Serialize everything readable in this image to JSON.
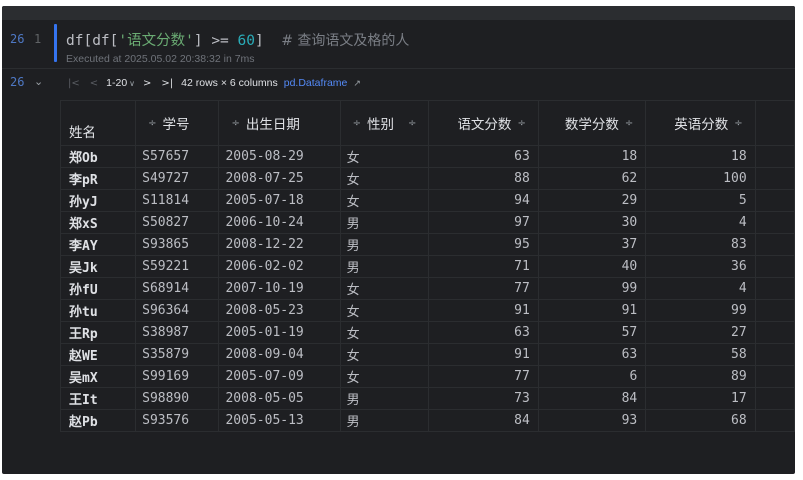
{
  "cell": {
    "execution_count": "26",
    "line_number": "1",
    "code": {
      "prefix": "df[df[",
      "string": "'语文分数'",
      "middle": "] >= ",
      "number": "60",
      "suffix": "]  ",
      "comment": "# 查询语文及格的人"
    },
    "executed_at": "Executed at 2025.05.02 20:38:32 in 7ms"
  },
  "output": {
    "execution_count": "26",
    "pager": {
      "first": "|<",
      "prev": "<",
      "range": "1-20",
      "next": ">",
      "last": ">|",
      "summary": "42 rows × 6 columns",
      "type_link": "pd.Dataframe",
      "ext_icon": "↗"
    },
    "table": {
      "index_name": "姓名",
      "columns": [
        {
          "key": "id",
          "label": "学号",
          "align": "left"
        },
        {
          "key": "dob",
          "label": "出生日期",
          "align": "left"
        },
        {
          "key": "sex",
          "label": "性别",
          "align": "left"
        },
        {
          "key": "chinese",
          "label": "语文分数",
          "align": "right"
        },
        {
          "key": "math",
          "label": "数学分数",
          "align": "right"
        },
        {
          "key": "english",
          "label": "英语分数",
          "align": "right"
        }
      ],
      "rows": [
        {
          "name": "郑Ob",
          "id": "S57657",
          "dob": "2005-08-29",
          "sex": "女",
          "chinese": "63",
          "math": "18",
          "english": "18"
        },
        {
          "name": "李pR",
          "id": "S49727",
          "dob": "2008-07-25",
          "sex": "女",
          "chinese": "88",
          "math": "62",
          "english": "100"
        },
        {
          "name": "孙yJ",
          "id": "S11814",
          "dob": "2005-07-18",
          "sex": "女",
          "chinese": "94",
          "math": "29",
          "english": "5"
        },
        {
          "name": "郑xS",
          "id": "S50827",
          "dob": "2006-10-24",
          "sex": "男",
          "chinese": "97",
          "math": "30",
          "english": "4"
        },
        {
          "name": "李AY",
          "id": "S93865",
          "dob": "2008-12-22",
          "sex": "男",
          "chinese": "95",
          "math": "37",
          "english": "83"
        },
        {
          "name": "吴Jk",
          "id": "S59221",
          "dob": "2006-02-02",
          "sex": "男",
          "chinese": "71",
          "math": "40",
          "english": "36"
        },
        {
          "name": "孙fU",
          "id": "S68914",
          "dob": "2007-10-19",
          "sex": "女",
          "chinese": "77",
          "math": "99",
          "english": "4"
        },
        {
          "name": "孙tu",
          "id": "S96364",
          "dob": "2008-05-23",
          "sex": "女",
          "chinese": "91",
          "math": "91",
          "english": "99"
        },
        {
          "name": "王Rp",
          "id": "S38987",
          "dob": "2005-01-19",
          "sex": "女",
          "chinese": "63",
          "math": "57",
          "english": "27"
        },
        {
          "name": "赵WE",
          "id": "S35879",
          "dob": "2008-09-04",
          "sex": "女",
          "chinese": "91",
          "math": "63",
          "english": "58"
        },
        {
          "name": "吴mX",
          "id": "S99169",
          "dob": "2005-07-09",
          "sex": "女",
          "chinese": "77",
          "math": "6",
          "english": "89"
        },
        {
          "name": "王It",
          "id": "S98890",
          "dob": "2008-05-05",
          "sex": "男",
          "chinese": "73",
          "math": "84",
          "english": "17"
        },
        {
          "name": "赵Pb",
          "id": "S93576",
          "dob": "2005-05-13",
          "sex": "男",
          "chinese": "84",
          "math": "93",
          "english": "68"
        }
      ]
    }
  },
  "colors": {
    "background": "#1e1f22",
    "accent": "#3574f0",
    "link": "#548af7",
    "string": "#6aab73",
    "number": "#2aacb8"
  }
}
